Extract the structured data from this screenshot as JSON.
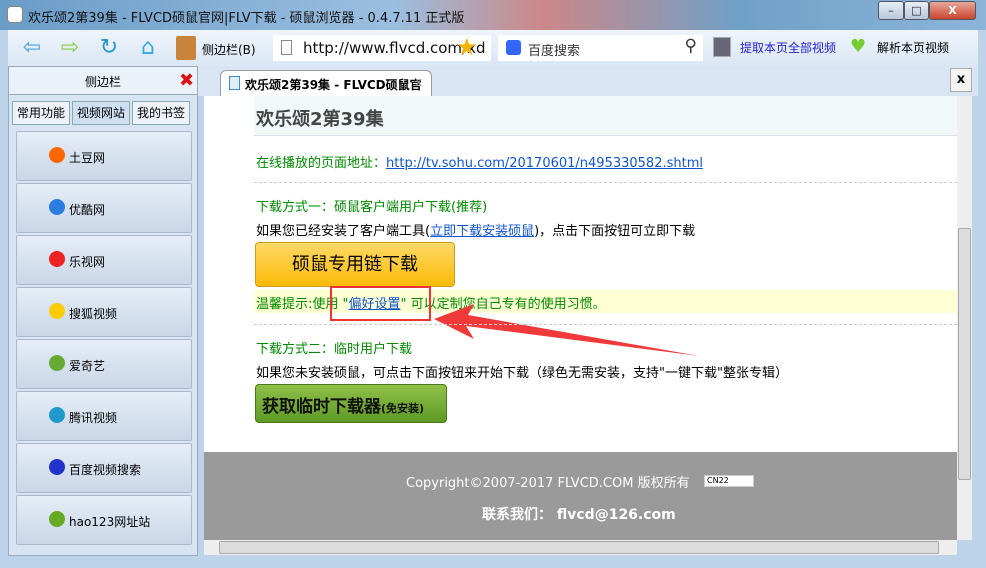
{
  "window": {
    "title": "欢乐颂2第39集 - FLVCD硕鼠官网|FLV下载 - 硕鼠浏览器 - 0.4.7.11 正式版",
    "min": "–",
    "max": "□",
    "close": "X"
  },
  "toolbar": {
    "sidebar_label": "侧边栏(B)",
    "address": "http://www.flvcd.com/xd",
    "search_placeholder": "百度搜索",
    "extract_all": "提取本页全部视频",
    "parse_page": "解析本页视频"
  },
  "sidebar": {
    "title": "侧边栏",
    "tabs": [
      "常用功能",
      "视频网站",
      "我的书签"
    ],
    "items": [
      {
        "label": "土豆网",
        "color": "#f60"
      },
      {
        "label": "优酷网",
        "color": "#2a7de1"
      },
      {
        "label": "乐视网",
        "color": "#e22"
      },
      {
        "label": "搜狐视频",
        "color": "#fc0"
      },
      {
        "label": "爱奇艺",
        "color": "#6a3"
      },
      {
        "label": "腾讯视频",
        "color": "#29c"
      },
      {
        "label": "百度视频搜索",
        "color": "#23c"
      },
      {
        "label": "hao123网址站",
        "color": "#6a2"
      }
    ]
  },
  "tab": {
    "label": "欢乐颂2第39集 - FLVCD硕鼠官",
    "close": "x",
    "close_all": "x"
  },
  "page": {
    "heading": "欢乐颂2第39集",
    "url_label": "在线播放的页面地址：",
    "url": "http://tv.sohu.com/20170601/n495330582.shtml",
    "method1_title": "下载方式一：硕鼠客户端用户下载(推荐)",
    "method1_text_a": "如果您已经安装了客户端工具(",
    "method1_link": "立即下载安装硕鼠",
    "method1_text_b": ")，点击下面按钮可立即下载",
    "method1_button": "硕鼠专用链下载",
    "tip_a": "温馨提示:使用 \"",
    "tip_link": "偏好设置",
    "tip_b": "\" 可以定制您自己专有的使用习惯。",
    "method2_title": "下载方式二：临时用户下载",
    "method2_text": "如果您未安装硕鼠，可点击下面按钮来开始下载（绿色无需安装，支持\"一键下载\"整张专辑）",
    "method2_button": "获取临时下载器",
    "method2_button_note": "(免安装)",
    "copyright": "Copyright©2007-2017 FLVCD.COM 版权所有",
    "contact": "联系我们： flvcd@126.com",
    "badge": "CN22"
  }
}
